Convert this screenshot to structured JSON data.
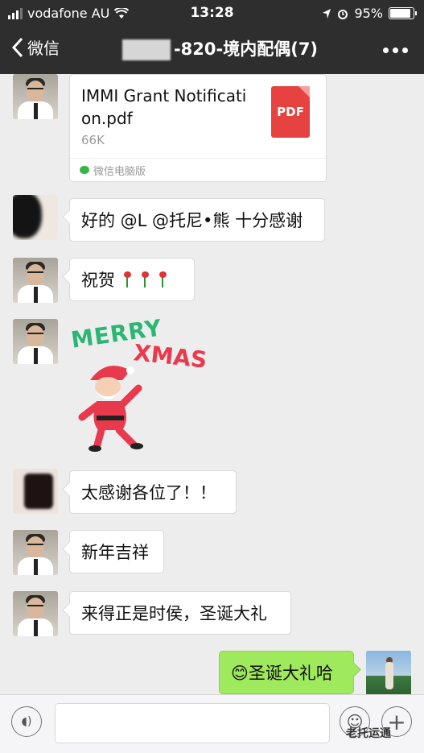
{
  "status_bar": {
    "carrier": "vodafone AU",
    "time": "13:28",
    "battery": "95%",
    "battery_level": 0.95,
    "signal_bars": 3
  },
  "nav": {
    "back_label": "微信",
    "title": "-820-境内配偶(7)"
  },
  "messages": [
    {
      "type": "file",
      "file_name": "IMMI Grant Notification.pdf",
      "file_name_line1": "IMMI Grant Notificati",
      "file_name_line2": "on.pdf",
      "file_size": "66K",
      "file_icon_label": "PDF",
      "source": "微信电脑版"
    },
    {
      "type": "text",
      "text": "好的 @L @托尼•熊 十分感谢"
    },
    {
      "type": "text",
      "text": "祝贺"
    },
    {
      "type": "sticker",
      "sticker_text_1": "MERRY",
      "sticker_text_2": "XMAS"
    },
    {
      "type": "text",
      "text": "太感谢各位了！！"
    },
    {
      "type": "text",
      "text": "新年吉祥"
    },
    {
      "type": "text",
      "text": "来得正是时侯，圣诞大礼"
    },
    {
      "type": "text",
      "text": "😊圣诞大礼哈"
    }
  ],
  "watermark": "老托运通",
  "colors": {
    "topbar": "#2e2e2e",
    "chat_bg": "#ededed",
    "my_bubble": "#9fe95c",
    "pdf_red": "#e64340"
  }
}
